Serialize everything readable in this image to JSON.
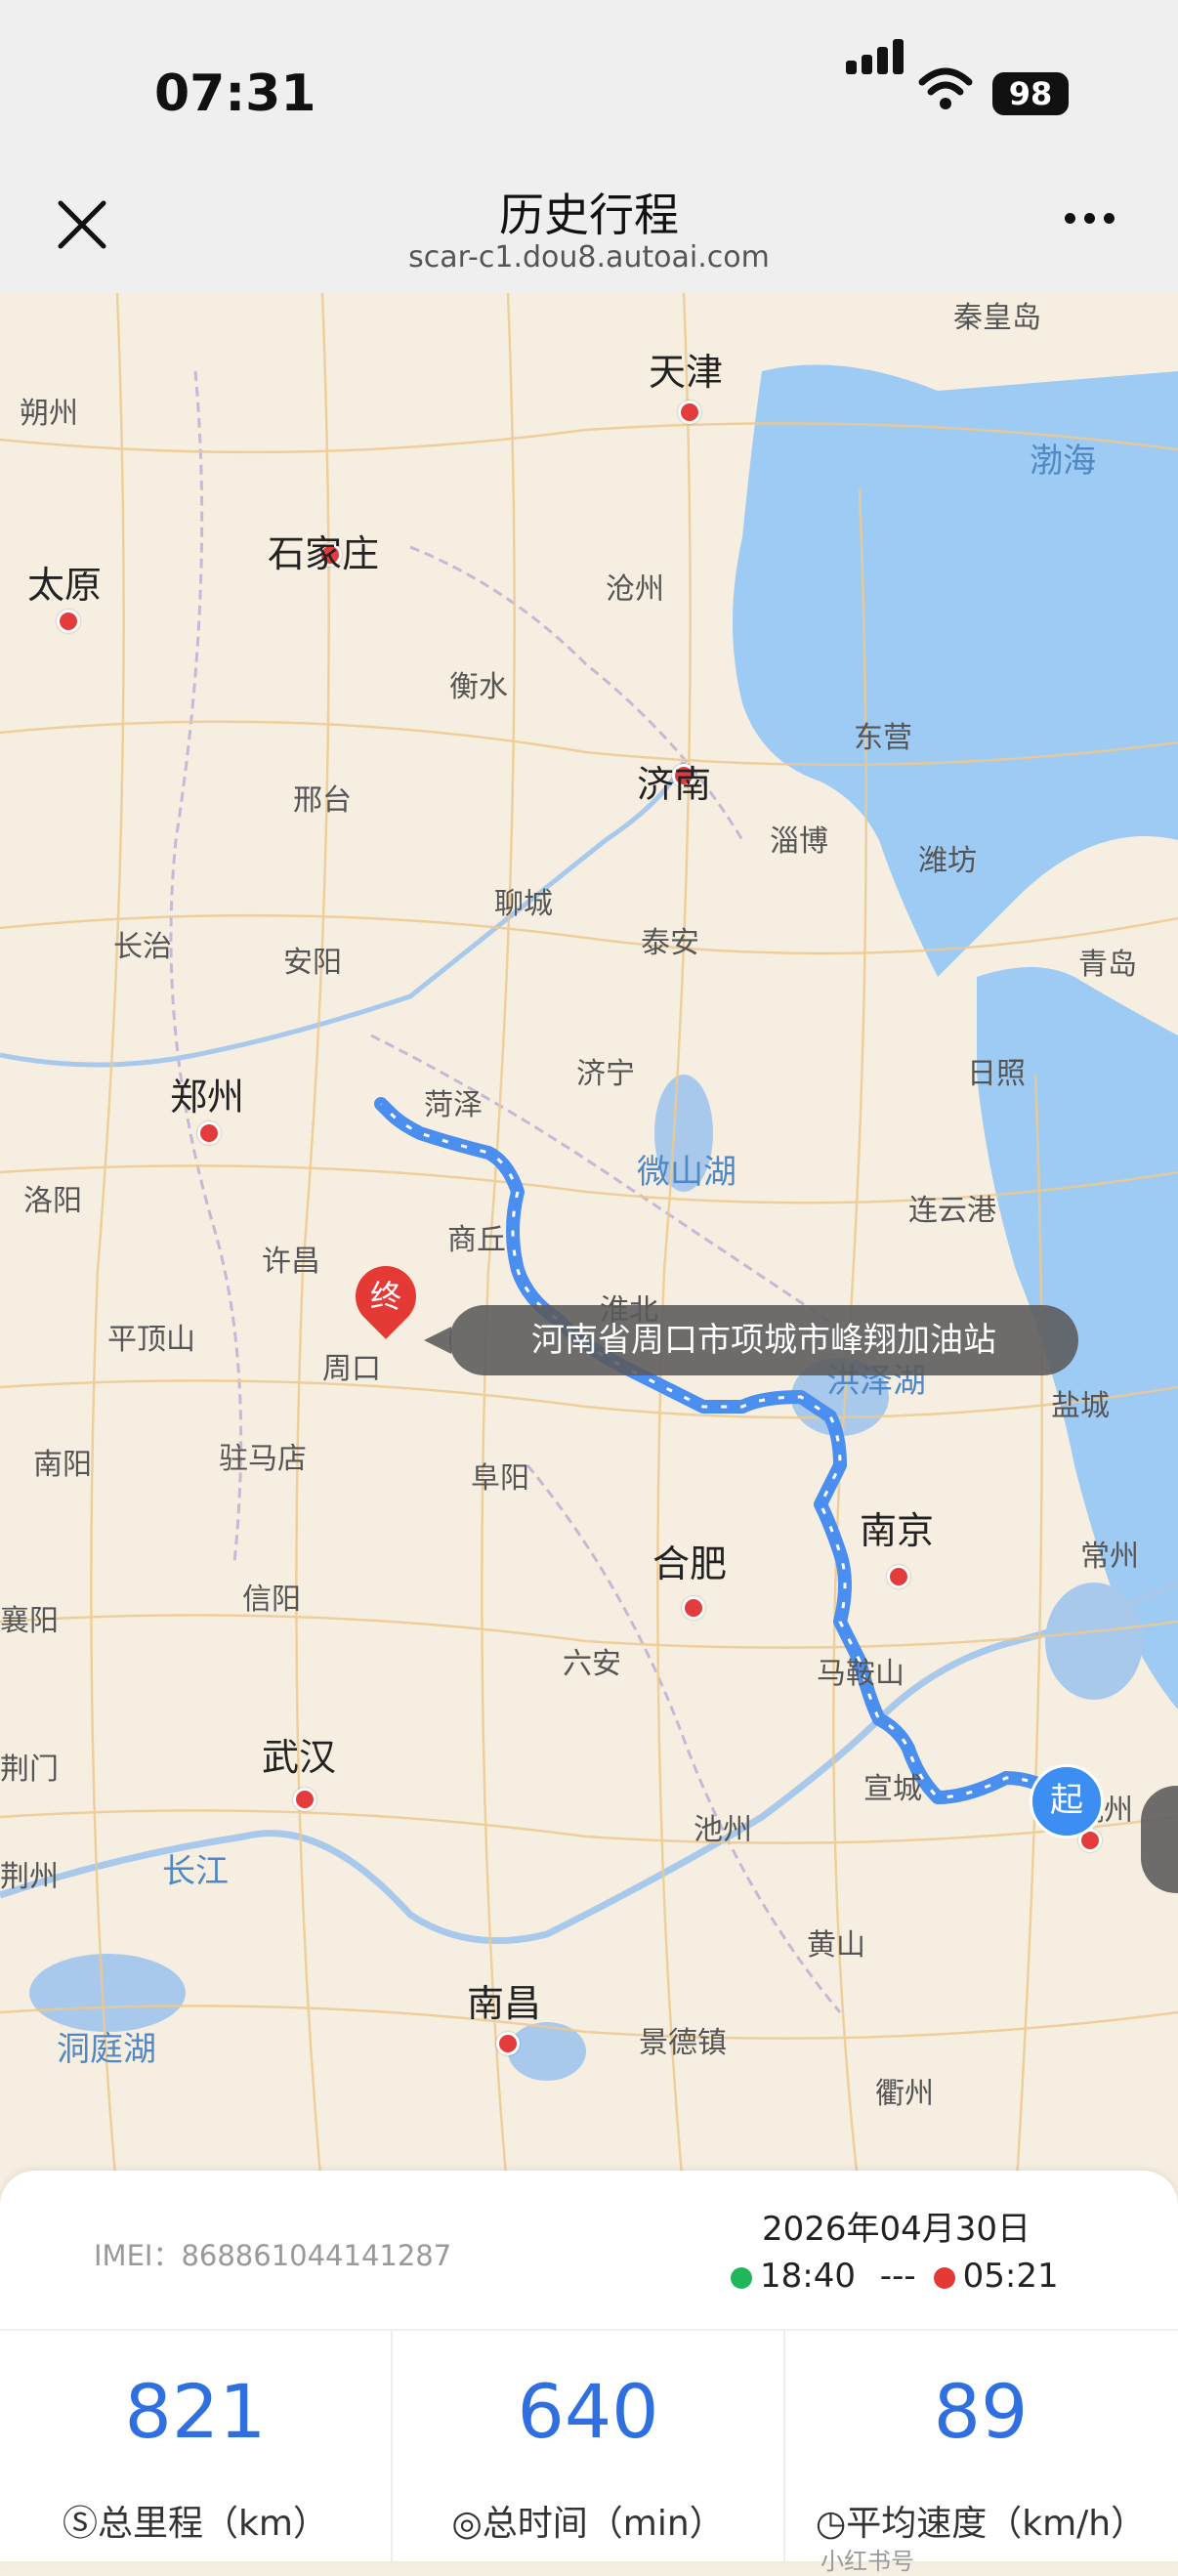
{
  "status": {
    "time": "07:31",
    "battery": "98"
  },
  "nav": {
    "title": "历史行程",
    "subtitle": "scar-c1.dou8.autoai.com"
  },
  "map": {
    "cities_major": [
      "天津",
      "石家庄",
      "太原",
      "济南",
      "郑州",
      "南京",
      "合肥",
      "武汉",
      "南昌"
    ],
    "cities_minor": [
      "秦皇岛",
      "朔州",
      "沧州",
      "衡水",
      "东营",
      "邢台",
      "淄博",
      "潍坊",
      "聊城",
      "长治",
      "安阳",
      "泰安",
      "青岛",
      "菏泽",
      "济宁",
      "日照",
      "洛阳",
      "商丘",
      "连云港",
      "许昌",
      "淮北",
      "平顶山",
      "周口",
      "盐城",
      "南阳",
      "驻马店",
      "阜阳",
      "常州",
      "信阳",
      "六安",
      "马鞍山",
      "荆门",
      "宣城",
      "池州",
      "荆州",
      "黄山",
      "景德镇",
      "衢州",
      "杭州",
      "襄阳"
    ],
    "water": [
      "渤海",
      "微山湖",
      "洪泽湖",
      "长江",
      "洞庭湖"
    ],
    "route_color": "#4a8ff0",
    "start_label": "起",
    "end_label": "终",
    "end_location": "河南省周口市项城市峰翔加油站"
  },
  "trip": {
    "imei": "IMEI：868861044141287",
    "date": "2026年04月30日",
    "start_time": "18:40",
    "dash": "---",
    "end_time": "05:21"
  },
  "stats": [
    {
      "value": "821",
      "label": "总里程（km）",
      "icon": "mileage-icon"
    },
    {
      "value": "640",
      "label": "总时间（min）",
      "icon": "clock-icon"
    },
    {
      "value": "89",
      "label": "平均速度（km/h）",
      "icon": "speed-icon"
    }
  ],
  "watermark": "小红书号"
}
